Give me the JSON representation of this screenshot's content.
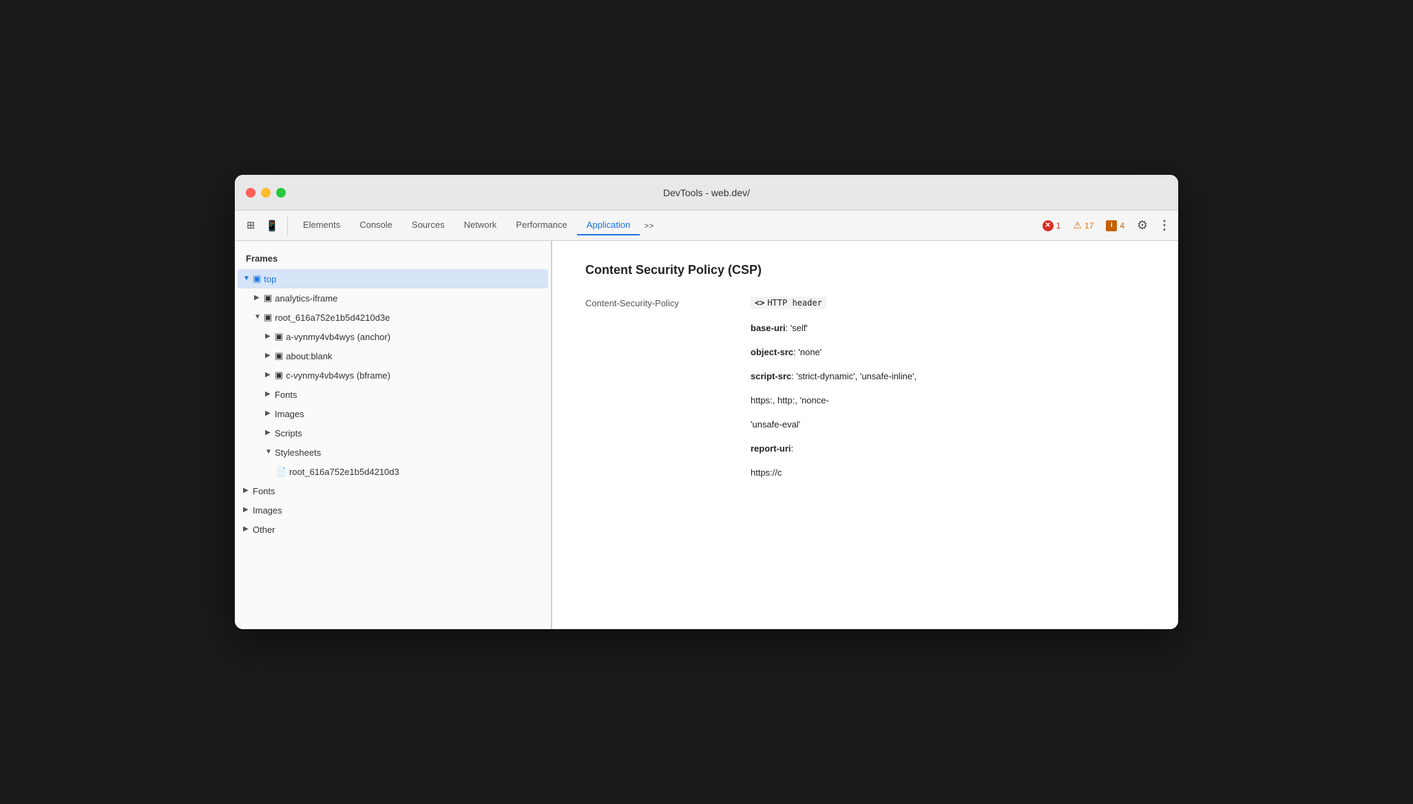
{
  "window": {
    "title": "DevTools - web.dev/"
  },
  "toolbar": {
    "tabs": [
      {
        "id": "elements",
        "label": "Elements",
        "active": false
      },
      {
        "id": "console",
        "label": "Console",
        "active": false
      },
      {
        "id": "sources",
        "label": "Sources",
        "active": false
      },
      {
        "id": "network",
        "label": "Network",
        "active": false
      },
      {
        "id": "performance",
        "label": "Performance",
        "active": false
      },
      {
        "id": "application",
        "label": "Application",
        "active": true
      }
    ],
    "more_tabs": ">>",
    "error_count": "1",
    "warning_count": "17",
    "info_count": "4"
  },
  "sidebar": {
    "section_label": "Frames",
    "items": [
      {
        "id": "top",
        "label": "top",
        "indent": 0,
        "type": "folder",
        "expanded": true,
        "selected": false
      },
      {
        "id": "analytics-iframe",
        "label": "analytics-iframe",
        "indent": 1,
        "type": "folder",
        "expanded": false,
        "selected": false
      },
      {
        "id": "root-frame",
        "label": "root_616a752e1b5d4210d3e",
        "indent": 1,
        "type": "folder",
        "expanded": true,
        "selected": false
      },
      {
        "id": "a-vynmy",
        "label": "a-vynmy4vb4wys (anchor)",
        "indent": 2,
        "type": "folder",
        "expanded": false,
        "selected": false
      },
      {
        "id": "about-blank",
        "label": "about:blank",
        "indent": 2,
        "type": "folder",
        "expanded": false,
        "selected": false
      },
      {
        "id": "c-vynmy",
        "label": "c-vynmy4vb4wys (bframe)",
        "indent": 2,
        "type": "folder",
        "expanded": false,
        "selected": false
      },
      {
        "id": "fonts-sub",
        "label": "Fonts",
        "indent": 2,
        "type": "group",
        "expanded": false,
        "selected": false
      },
      {
        "id": "images-sub",
        "label": "Images",
        "indent": 2,
        "type": "group",
        "expanded": false,
        "selected": false
      },
      {
        "id": "scripts-sub",
        "label": "Scripts",
        "indent": 2,
        "type": "group",
        "expanded": false,
        "selected": false
      },
      {
        "id": "stylesheets-sub",
        "label": "Stylesheets",
        "indent": 2,
        "type": "group",
        "expanded": true,
        "selected": false
      },
      {
        "id": "stylesheet-file",
        "label": "root_616a752e1b5d4210d3",
        "indent": 3,
        "type": "file",
        "selected": false
      },
      {
        "id": "fonts-top",
        "label": "Fonts",
        "indent": 0,
        "type": "group",
        "expanded": false,
        "selected": false
      },
      {
        "id": "images-top",
        "label": "Images",
        "indent": 0,
        "type": "group",
        "expanded": false,
        "selected": false
      },
      {
        "id": "other-top",
        "label": "Other",
        "indent": 0,
        "type": "group",
        "expanded": false,
        "selected": false
      }
    ]
  },
  "content": {
    "title": "Content Security Policy (CSP)",
    "csp_key": "Content-Security-Policy",
    "csp_type_icon": "<>",
    "csp_type_label": "HTTP header",
    "directives": [
      {
        "name": "base-uri",
        "value": "'self'"
      },
      {
        "name": "object-src",
        "value": "'none'"
      },
      {
        "name": "script-src",
        "value": "'strict-dynamic', 'unsafe-inline',"
      },
      {
        "name": "",
        "value": "https:, http:, 'nonce-"
      },
      {
        "name": "",
        "value": "'unsafe-eval'"
      },
      {
        "name": "report-uri",
        "value": ""
      },
      {
        "name": "",
        "value": "https://c"
      }
    ]
  },
  "icons": {
    "selector_icon": "⊡",
    "device_icon": "▣",
    "gear": "⚙",
    "more_vert": "⋮",
    "error_icon": "✕",
    "warning_icon": "▲",
    "info_icon": "▮",
    "folder": "▣",
    "arrow_right": "▶",
    "arrow_down": "▼",
    "file": "📄"
  },
  "colors": {
    "active_tab": "#1a73e8",
    "error_red": "#d93025",
    "warning_orange": "#e37400",
    "info_orange": "#c46000",
    "selected_bg": "#d6e4f7"
  }
}
